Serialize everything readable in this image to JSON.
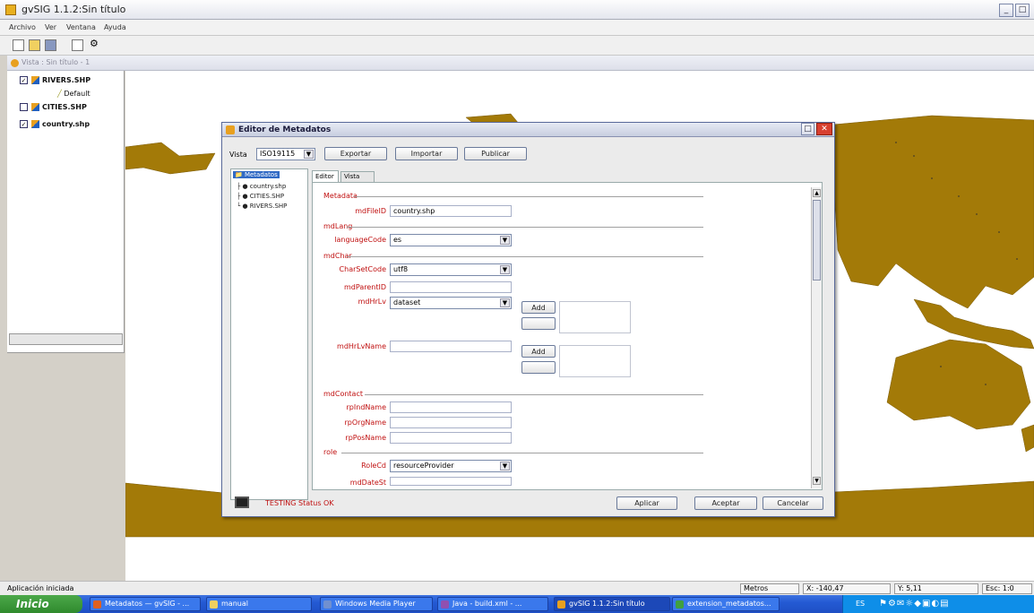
{
  "app": {
    "title": "gvSIG 1.1.2:Sin título",
    "menu": [
      "Archivo",
      "Ver",
      "Ventana",
      "Ayuda"
    ]
  },
  "view": {
    "title": "Vista : Sin título - 1"
  },
  "toc": {
    "layers": [
      {
        "name": "RIVERS.SHP",
        "checked": true
      },
      {
        "name": "Default",
        "legend": true
      },
      {
        "name": "CITIES.SHP",
        "checked": false
      },
      {
        "name": "country.shp",
        "checked": true
      }
    ]
  },
  "dialog": {
    "title": "Editor de Metadatos",
    "vista_label": "Vista",
    "vista_value": "ISO19115",
    "buttons_top": [
      "Exportar",
      "Importar",
      "Publicar"
    ],
    "tabs": [
      "Editor",
      "Vista XML"
    ],
    "tree": {
      "root": "Metadatos",
      "items": [
        "country.shp",
        "CITIES.SHP",
        "RIVERS.SHP"
      ]
    },
    "sections": {
      "metadata": "Metadata",
      "mdFileID_label": "mdFileID",
      "mdFileID_value": "country.shp",
      "mdLang": "mdLang",
      "languageCode_label": "languageCode",
      "languageCode_value": "es",
      "mdChar": "mdChar",
      "charSetCode_label": "CharSetCode",
      "charSetCode_value": "utf8",
      "mdParentID_label": "mdParentID",
      "mdHr_label": "mdHrLv",
      "mdHr_value": "dataset",
      "hierLevelName_label": "mdHrLvName",
      "mdContact": "mdContact",
      "rpIndName_label": "rpIndName",
      "rpOrgName_label": "rpOrgName",
      "rpPosName_label": "rpPosName",
      "role": "role",
      "roleCode_label": "RoleCd",
      "roleCode_value": "resourceProvider",
      "mdDateSt_label": "mdDateSt",
      "small_btn": "Add",
      "small_btn2": "Add"
    },
    "status_text": "TESTING Status OK",
    "buttons_bottom": [
      "Aplicar",
      "Aceptar",
      "Cancelar"
    ]
  },
  "status": {
    "left": "Aplicación iniciada",
    "cells": [
      "Metros",
      "X: -140,47",
      "Y: 5,11",
      "Esc: 1:0"
    ]
  },
  "taskbar": {
    "start": "Inicio",
    "tasks": [
      "Metadatos — gvSIG - ...",
      "manual",
      "Windows Media Player",
      "Java - build.xml - ...",
      "gvSIG 1.1.2:Sin título",
      "extension_metadatos..."
    ],
    "clock": "ES"
  },
  "colors": {
    "land": "#a37a08",
    "accent_red": "#c01010",
    "taskbar": "#245ad4"
  }
}
